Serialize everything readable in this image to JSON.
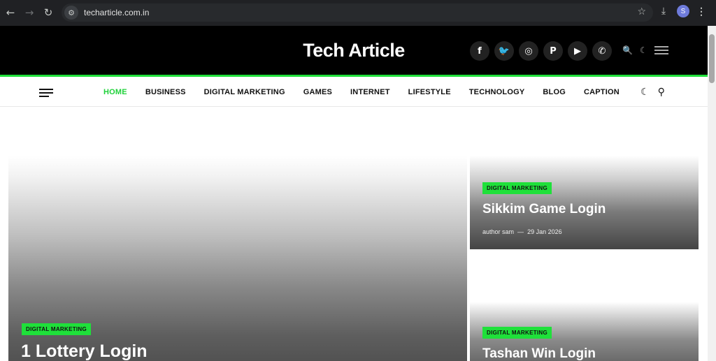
{
  "browser": {
    "url": "techarticle.com.in",
    "profile_initial": "S"
  },
  "site": {
    "title": "Tech Article",
    "accent_color": "#1fe03a",
    "socials": [
      {
        "name": "facebook-icon",
        "glyph": "f"
      },
      {
        "name": "twitter-icon",
        "glyph": "🐦"
      },
      {
        "name": "instagram-icon",
        "glyph": "◎"
      },
      {
        "name": "pinterest-icon",
        "glyph": "P"
      },
      {
        "name": "youtube-icon",
        "glyph": "▶"
      },
      {
        "name": "whatsapp-icon",
        "glyph": "✆"
      }
    ]
  },
  "nav": {
    "items": [
      "HOME",
      "BUSINESS",
      "DIGITAL MARKETING",
      "GAMES",
      "INTERNET",
      "LIFESTYLE",
      "TECHNOLOGY",
      "BLOG",
      "CAPTION"
    ],
    "active_index": 0
  },
  "articles": {
    "main": {
      "category": "DIGITAL MARKETING",
      "title": "1 Lottery Login"
    },
    "side1": {
      "category": "DIGITAL MARKETING",
      "title": "Sikkim Game Login",
      "author": "author sam",
      "separator": "—",
      "date": "29 Jan 2026"
    },
    "side2": {
      "category": "DIGITAL MARKETING",
      "title": "Tashan Win Login"
    }
  }
}
